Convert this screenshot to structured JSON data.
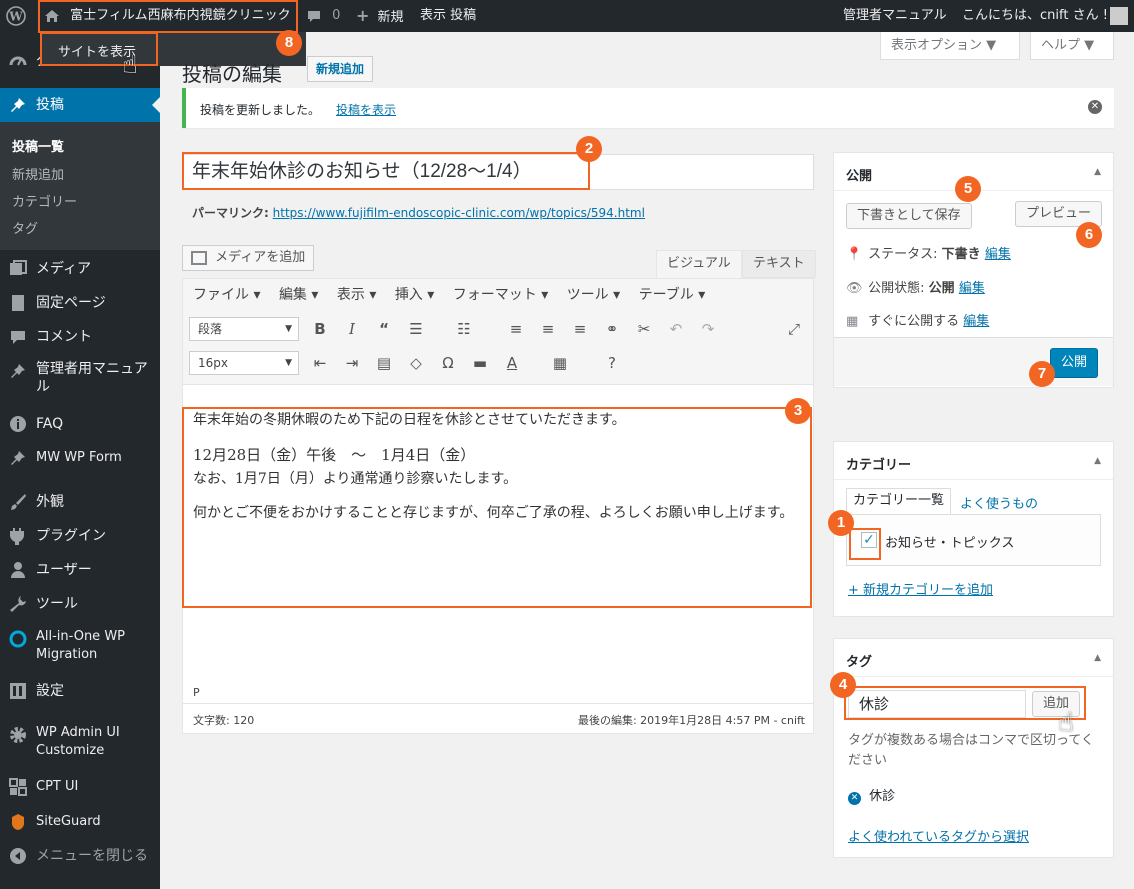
{
  "adminbar": {
    "site_name": "富士フィルム西麻布内視鏡クリニック",
    "comments_count": "0",
    "new_label": "新規",
    "view_label": "表示 投稿",
    "manual_label": "管理者マニュアル",
    "howdy": "こんにちは、cnift さん !",
    "dropdown_view_site": "サイトを表示"
  },
  "sidebar": {
    "dashboard": "ダッシュボード",
    "posts": "投稿",
    "sub_posts_list": "投稿一覧",
    "sub_add_new": "新規追加",
    "sub_categories": "カテゴリー",
    "sub_tags": "タグ",
    "media": "メディア",
    "pages": "固定ページ",
    "comments": "コメント",
    "manual": "管理者用マニュアル",
    "faq": "FAQ",
    "mwwpform": "MW WP Form",
    "appearance": "外観",
    "plugins": "プラグイン",
    "users": "ユーザー",
    "tools": "ツール",
    "migration": "All-in-One WP Migration",
    "settings": "設定",
    "admin_ui": "WP Admin UI Customize",
    "cpt_ui": "CPT UI",
    "siteguard": "SiteGuard",
    "collapse": "メニューを閉じる"
  },
  "header": {
    "screen_options": "表示オプション ▼",
    "help": "ヘルプ ▼",
    "page_title": "投稿の編集",
    "add_new": "新規追加"
  },
  "notice": {
    "text": "投稿を更新しました。",
    "link": "投稿を表示"
  },
  "post": {
    "title": "年末年始休診のお知らせ（12/28～1/4）",
    "permalink_label": "パーマリンク:",
    "permalink_url": "https://www.fujifilm-endoscopic-clinic.com/wp/topics/594.html"
  },
  "editor": {
    "add_media": "メディアを追加",
    "tab_visual": "ビジュアル",
    "tab_text": "テキスト",
    "menu": [
      "ファイル ▾",
      "編集 ▾",
      "表示 ▾",
      "挿入 ▾",
      "フォーマット ▾",
      "ツール ▾",
      "テーブル ▾"
    ],
    "format_select": "段落",
    "size_select": "16px",
    "content": {
      "p1": "年末年始の冬期休暇のため下記の日程を休診とさせていただきます。",
      "p2": "12月28日（金）午後　～　1月4日（金）",
      "p3": "なお、1月7日（月）より通常通り診察いたします。",
      "p4": "何かとご不便をおかけすることと存じますが、何卒ご了承の程、よろしくお願い申し上げます。"
    },
    "path": "P",
    "word_count": "文字数: 120",
    "last_edited": "最後の編集: 2019年1月28日 4:57 PM - cnift"
  },
  "publish": {
    "title": "公開",
    "save_draft": "下書きとして保存",
    "preview": "プレビュー",
    "status_label": "ステータス:",
    "status_value": "下書き",
    "visibility_label": "公開状態:",
    "visibility_value": "公開",
    "schedule": "すぐに公開する",
    "edit": "編集",
    "publish_button": "公開"
  },
  "categories": {
    "title": "カテゴリー",
    "tab_all": "カテゴリー一覧",
    "tab_popular": "よく使うもの",
    "item": "お知らせ・トピックス",
    "add_new": "+ 新規カテゴリーを追加"
  },
  "tags": {
    "title": "タグ",
    "input_value": "休診",
    "add_button": "追加",
    "hint": "タグが複数ある場合はコンマで区切ってください",
    "tag_item": "休診",
    "choose_popular": "よく使われているタグから選択"
  },
  "callouts": [
    "1",
    "2",
    "3",
    "4",
    "5",
    "6",
    "7",
    "8"
  ],
  "colors": {
    "accent": "#0073aa",
    "callout": "#f26522",
    "adminbar": "#23282d"
  }
}
